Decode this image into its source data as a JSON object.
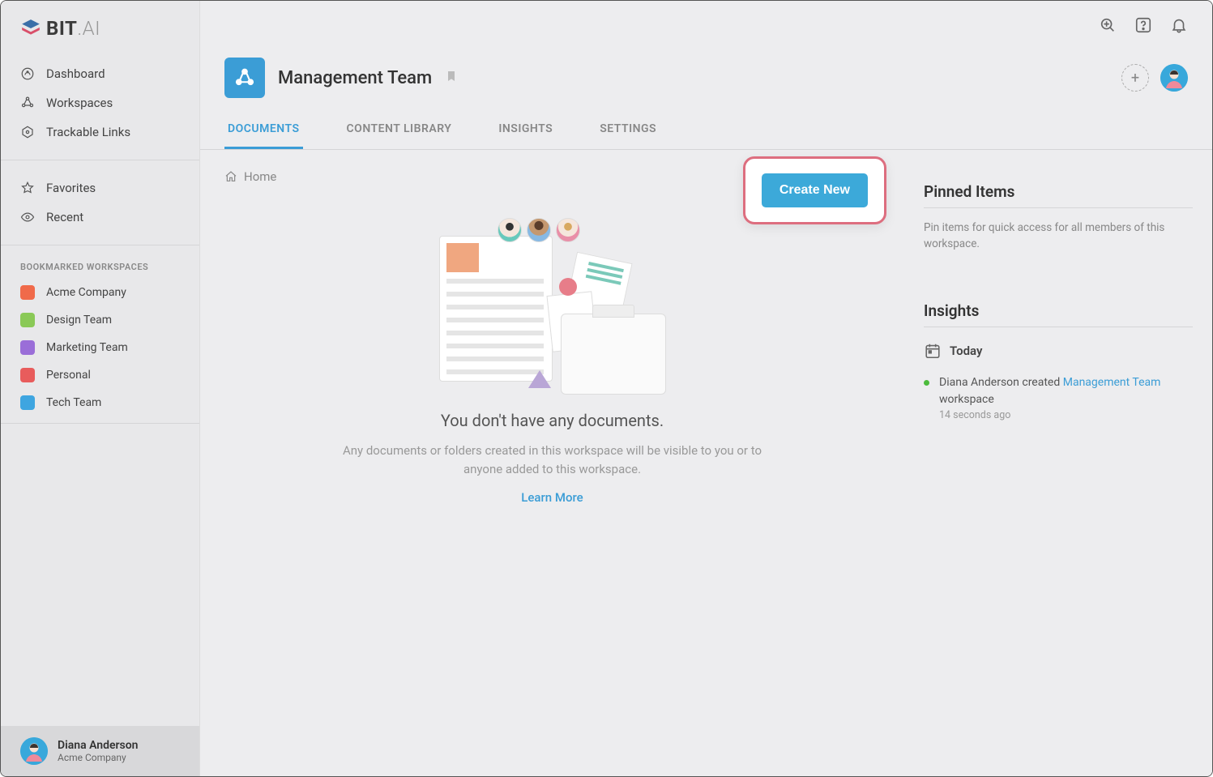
{
  "brand": {
    "name": "BIT",
    "suffix": ".AI"
  },
  "sidebar": {
    "nav": [
      {
        "label": "Dashboard",
        "icon": "dashboard-icon"
      },
      {
        "label": "Workspaces",
        "icon": "workspaces-icon"
      },
      {
        "label": "Trackable Links",
        "icon": "links-icon"
      }
    ],
    "quick": [
      {
        "label": "Favorites",
        "icon": "star-icon"
      },
      {
        "label": "Recent",
        "icon": "eye-icon"
      }
    ],
    "bookmarked_label": "BOOKMARKED WORKSPACES",
    "workspaces": [
      {
        "label": "Acme Company",
        "color": "#f06a4a"
      },
      {
        "label": "Design Team",
        "color": "#8ac957"
      },
      {
        "label": "Marketing Team",
        "color": "#9a6ed8"
      },
      {
        "label": "Personal",
        "color": "#e85c5c"
      },
      {
        "label": "Tech Team",
        "color": "#3ea5e0"
      }
    ],
    "user": {
      "name": "Diana Anderson",
      "org": "Acme Company"
    }
  },
  "header": {
    "workspace_name": "Management Team"
  },
  "tabs": [
    {
      "label": "DOCUMENTS",
      "active": true
    },
    {
      "label": "CONTENT LIBRARY",
      "active": false
    },
    {
      "label": "INSIGHTS",
      "active": false
    },
    {
      "label": "SETTINGS",
      "active": false
    }
  ],
  "breadcrumb": {
    "home": "Home"
  },
  "create_button": "Create New",
  "empty_state": {
    "title": "You don't have any documents.",
    "description": "Any documents or folders created in this workspace will be visible to you or to anyone added to this workspace.",
    "learn_more": "Learn More"
  },
  "pinned": {
    "title": "Pinned Items",
    "hint": "Pin items for quick access for all members of this workspace."
  },
  "insights": {
    "title": "Insights",
    "date_label": "Today",
    "activity": {
      "prefix": "Diana Anderson created ",
      "link": "Management Team",
      "suffix": " workspace",
      "time": "14 seconds ago"
    }
  }
}
